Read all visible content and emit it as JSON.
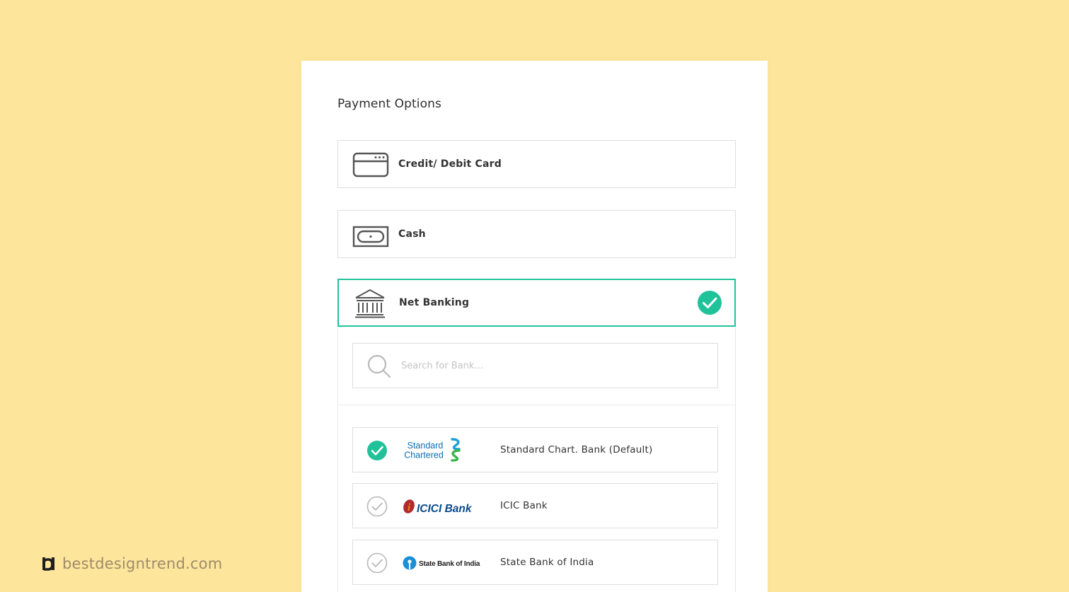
{
  "page": {
    "title": "Payment Options"
  },
  "payment_options": [
    {
      "label": "Credit/ Debit Card",
      "icon": "credit-card-icon",
      "selected": false
    },
    {
      "label": "Cash",
      "icon": "cash-icon",
      "selected": false
    },
    {
      "label": "Net Banking",
      "icon": "bank-icon",
      "selected": true
    }
  ],
  "bank_search": {
    "placeholder": "Search for Bank...",
    "icon": "search-icon"
  },
  "banks": [
    {
      "name": "Standard Chart. Bank (Default)",
      "logo_text": [
        "Standard",
        "Chartered"
      ],
      "selected": true
    },
    {
      "name": "ICIC Bank",
      "logo_text": "ICICI Bank",
      "selected": false
    },
    {
      "name": "State Bank of India",
      "logo_text": "State Bank of India",
      "selected": false
    }
  ],
  "watermark": {
    "text": "bestdesigntrend.com"
  },
  "colors": {
    "background": "#fde69c",
    "accent": "#20c29a",
    "card": "#ffffff",
    "border": "#dedede"
  }
}
